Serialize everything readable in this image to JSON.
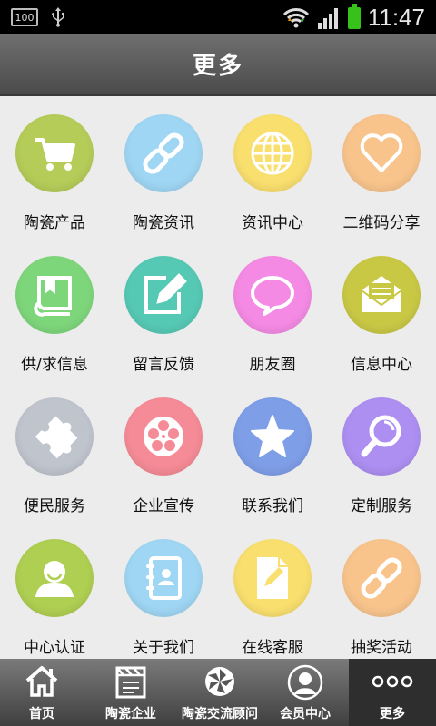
{
  "status_bar": {
    "battery_text": "100",
    "time": "11:47"
  },
  "header": {
    "title": "更多"
  },
  "items": [
    {
      "label": "陶瓷产品",
      "color": "#b5cc59",
      "icon": "cart-icon"
    },
    {
      "label": "陶瓷资讯",
      "color": "#9fd6f3",
      "icon": "link-icon"
    },
    {
      "label": "资讯中心",
      "color": "#f9df6e",
      "icon": "globe-icon"
    },
    {
      "label": "二维码分享",
      "color": "#f8c48c",
      "icon": "heart-icon"
    },
    {
      "label": "供/求信息",
      "color": "#7ed67b",
      "icon": "book-icon"
    },
    {
      "label": "留言反馈",
      "color": "#56c9b5",
      "icon": "edit-icon"
    },
    {
      "label": "朋友圈",
      "color": "#f48ae4",
      "icon": "speech-bubble-icon"
    },
    {
      "label": "信息中心",
      "color": "#c9c845",
      "icon": "mail-icon"
    },
    {
      "label": "便民服务",
      "color": "#bfc4cd",
      "icon": "puzzle-icon"
    },
    {
      "label": "企业宣传",
      "color": "#f58b96",
      "icon": "film-reel-icon"
    },
    {
      "label": "联系我们",
      "color": "#7f9ee8",
      "icon": "star-icon"
    },
    {
      "label": "定制服务",
      "color": "#ad8ff2",
      "icon": "magnifier-icon"
    },
    {
      "label": "中心认证",
      "color": "#afcf52",
      "icon": "user-icon"
    },
    {
      "label": "关于我们",
      "color": "#9fd6f3",
      "icon": "contacts-icon"
    },
    {
      "label": "在线客服",
      "color": "#f9df6e",
      "icon": "document-edit-icon"
    },
    {
      "label": "抽奖活动",
      "color": "#f8c48c",
      "icon": "link-icon"
    }
  ],
  "tabs": [
    {
      "label": "首页",
      "icon": "home-icon",
      "active": false
    },
    {
      "label": "陶瓷企业",
      "icon": "clapperboard-icon",
      "active": false
    },
    {
      "label": "陶瓷交流顾问",
      "icon": "aperture-icon",
      "active": false
    },
    {
      "label": "会员中心",
      "icon": "member-icon",
      "active": false
    },
    {
      "label": "更多",
      "icon": "more-dots-icon",
      "active": true
    }
  ]
}
